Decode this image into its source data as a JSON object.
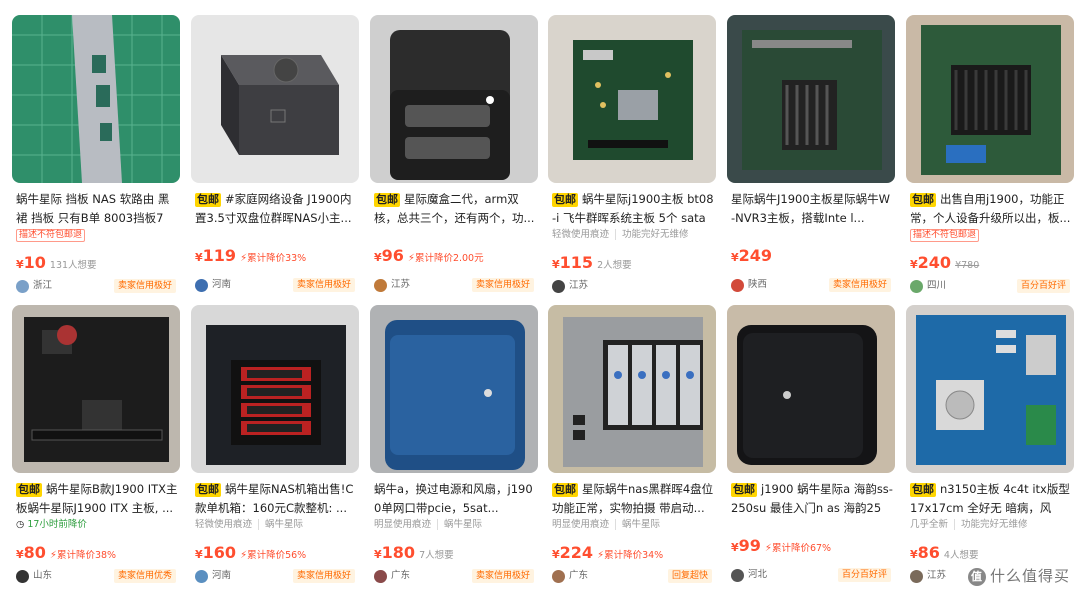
{
  "items": [
    {
      "baoyou": false,
      "title": "蜗牛星际 挡板 NAS 软路由 黑裙 挡板 只有B单 8003挡板75...",
      "tags": [
        {
          "kind": "box",
          "text": "描述不符包邮退"
        }
      ],
      "price": "10",
      "cut": "",
      "want": "131人想要",
      "orig": "",
      "region": "浙江",
      "credit": "卖家信用极好",
      "avatar_color": "#7aa0c8"
    },
    {
      "baoyou": true,
      "baoyou_label": "包邮",
      "title": "#家庭网络设备 J1900内置3.5寸双盘位群晖NAS小主...",
      "tags": [],
      "price": "119",
      "cut": "累计降价33%",
      "want": "",
      "orig": "",
      "region": "河南",
      "credit": "卖家信用极好",
      "avatar_color": "#3e6fb0"
    },
    {
      "baoyou": true,
      "baoyou_label": "包邮",
      "title": "星际魔盒二代，arm双核，总共三个，还有两个，功...",
      "tags": [],
      "price": "96",
      "cut": "累计降价2.00元",
      "want": "",
      "orig": "",
      "region": "江苏",
      "credit": "卖家信用极好",
      "avatar_color": "#c07a3a"
    },
    {
      "baoyou": true,
      "baoyou_label": "包邮",
      "title": "蜗牛星际j1900主板 bt08-i 飞牛群晖系统主板 5个 sata ...",
      "tags": [
        {
          "kind": "gray",
          "text": "轻微使用痕迹"
        },
        {
          "kind": "gray",
          "text": "功能完好无维修"
        }
      ],
      "price": "115",
      "cut": "",
      "want": "2人想要",
      "orig": "",
      "region": "江苏",
      "credit": "",
      "avatar_color": "#444"
    },
    {
      "baoyou": false,
      "title": "星际蜗牛J1900主板星际蜗牛W-NVR3主板，搭载Inte l...",
      "tags": [],
      "price": "249",
      "cut": "",
      "want": "",
      "orig": "",
      "region": "陕西",
      "credit": "卖家信用极好",
      "avatar_color": "#d24a3a"
    },
    {
      "baoyou": true,
      "baoyou_label": "包邮",
      "title": "出售自用j1900，功能正常，个人设备升级所以出，板...",
      "tags": [
        {
          "kind": "box",
          "text": "描述不符包邮退"
        }
      ],
      "price": "240",
      "cut": "",
      "want": "",
      "orig": "¥780",
      "region": "四川",
      "credit": "百分百好评",
      "avatar_color": "#6aa86a"
    },
    {
      "baoyou": true,
      "baoyou_label": "包邮",
      "title": "蜗牛星际B款J1900 ITX主板蜗牛星际J1900 ITX 主板, ...",
      "tags": [
        {
          "kind": "green",
          "text": "17小时前降价"
        }
      ],
      "price": "80",
      "cut": "累计降价38%",
      "want": "",
      "orig": "",
      "region": "山东",
      "credit": "卖家信用优秀",
      "avatar_color": "#333"
    },
    {
      "baoyou": true,
      "baoyou_label": "包邮",
      "title": "蜗牛星际NAS机箱出售!C款单机箱：160元C款整机: ...",
      "tags": [
        {
          "kind": "gray",
          "text": "轻微使用痕迹"
        },
        {
          "kind": "gray",
          "text": "蜗牛星际"
        }
      ],
      "price": "160",
      "cut": "累计降价56%",
      "want": "",
      "orig": "",
      "region": "河南",
      "credit": "卖家信用极好",
      "avatar_color": "#5a8fc0"
    },
    {
      "baoyou": false,
      "title": "蜗牛a，换过电源和风扇，j1900单网口带pcie，5sat...",
      "tags": [
        {
          "kind": "gray",
          "text": "明显使用痕迹"
        },
        {
          "kind": "gray",
          "text": "蜗牛星际"
        }
      ],
      "price": "180",
      "cut": "",
      "want": "7人想要",
      "orig": "",
      "region": "广东",
      "credit": "卖家信用极好",
      "avatar_color": "#8a4a4a"
    },
    {
      "baoyou": true,
      "baoyou_label": "包邮",
      "title": "星际蜗牛nas黑群晖4盘位功能正常，实物拍摄 带启动...",
      "tags": [
        {
          "kind": "gray",
          "text": "明显使用痕迹"
        },
        {
          "kind": "gray",
          "text": "蜗牛星际"
        }
      ],
      "price": "224",
      "cut": "累计降价34%",
      "want": "",
      "orig": "",
      "region": "广东",
      "credit": "回复超快",
      "avatar_color": "#a07050"
    },
    {
      "baoyou": true,
      "baoyou_label": "包邮",
      "title": "j1900 蜗牛星际a 海韵ss-250su 最佳入门n as 海韵250...",
      "tags": [],
      "price": "99",
      "cut": "累计降价67%",
      "want": "",
      "orig": "",
      "region": "河北",
      "credit": "百分百好评",
      "avatar_color": "#555"
    },
    {
      "baoyou": true,
      "baoyou_label": "包邮",
      "title": "n3150主板 4c4t itx版型 17x17cm 全好无 暗病，风扇...",
      "tags": [
        {
          "kind": "gray",
          "text": "几乎全新"
        },
        {
          "kind": "gray",
          "text": "功能完好无维修"
        }
      ],
      "price": "86",
      "cut": "",
      "want": "4人想要",
      "orig": "",
      "region": "江苏",
      "credit": "",
      "avatar_color": "#7a6a5a"
    }
  ],
  "currency": "¥",
  "watermark": {
    "logo": "值",
    "text": "什么值得买"
  }
}
